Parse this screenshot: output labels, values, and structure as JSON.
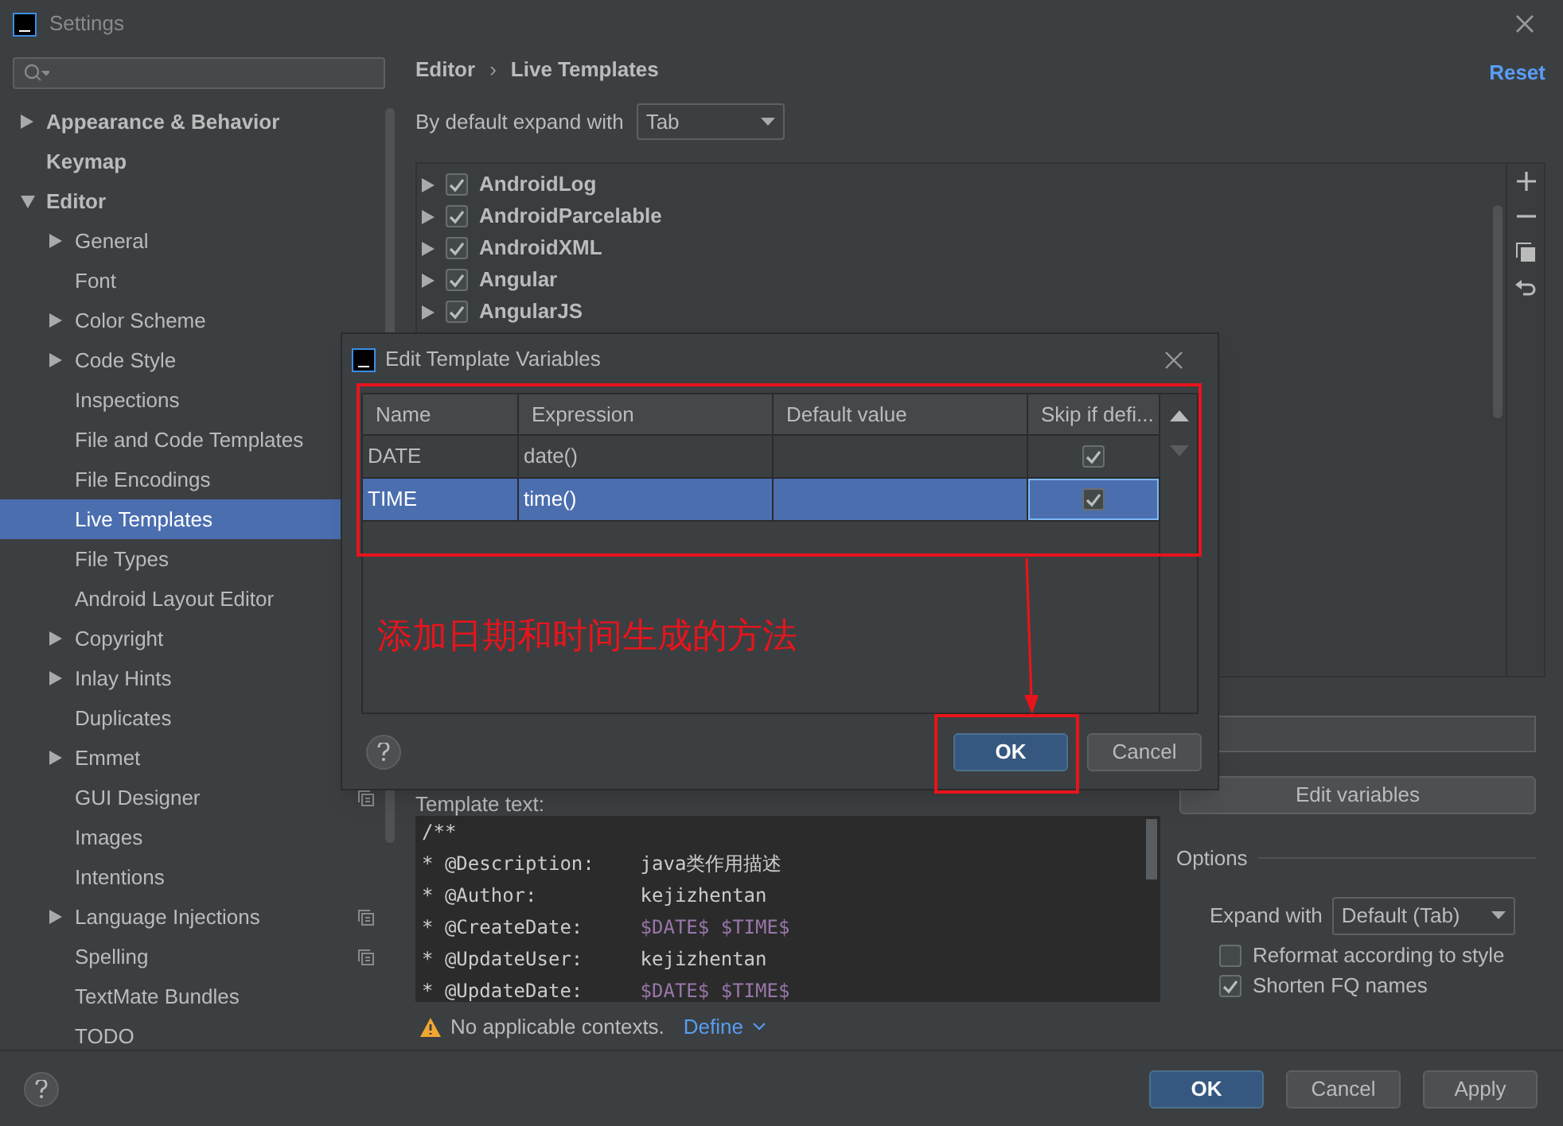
{
  "window": {
    "title": "Settings"
  },
  "sidebar": {
    "items": [
      {
        "label": "Appearance & Behavior",
        "kind": "folder",
        "expanded": false
      },
      {
        "label": "Keymap",
        "kind": "page"
      },
      {
        "label": "Editor",
        "kind": "folder",
        "expanded": true,
        "children": [
          {
            "label": "General",
            "kind": "folder",
            "expanded": false,
            "selected": false,
            "shared": false
          },
          {
            "label": "Font",
            "kind": "page",
            "selected": false,
            "shared": false
          },
          {
            "label": "Color Scheme",
            "kind": "folder",
            "expanded": false,
            "selected": false,
            "shared": false
          },
          {
            "label": "Code Style",
            "kind": "folder",
            "expanded": false,
            "selected": false,
            "shared": false
          },
          {
            "label": "Inspections",
            "kind": "page",
            "selected": false,
            "shared": false
          },
          {
            "label": "File and Code Templates",
            "kind": "page",
            "selected": false,
            "shared": false
          },
          {
            "label": "File Encodings",
            "kind": "page",
            "selected": false,
            "shared": false
          },
          {
            "label": "Live Templates",
            "kind": "page",
            "selected": true,
            "shared": false
          },
          {
            "label": "File Types",
            "kind": "page",
            "selected": false,
            "shared": false
          },
          {
            "label": "Android Layout Editor",
            "kind": "page",
            "selected": false,
            "shared": false
          },
          {
            "label": "Copyright",
            "kind": "folder",
            "expanded": false,
            "selected": false,
            "shared": false
          },
          {
            "label": "Inlay Hints",
            "kind": "folder",
            "expanded": false,
            "selected": false,
            "shared": false
          },
          {
            "label": "Duplicates",
            "kind": "page",
            "selected": false,
            "shared": false
          },
          {
            "label": "Emmet",
            "kind": "folder",
            "expanded": false,
            "selected": false,
            "shared": false
          },
          {
            "label": "GUI Designer",
            "kind": "page",
            "selected": false,
            "shared": true
          },
          {
            "label": "Images",
            "kind": "page",
            "selected": false,
            "shared": false
          },
          {
            "label": "Intentions",
            "kind": "page",
            "selected": false,
            "shared": false
          },
          {
            "label": "Language Injections",
            "kind": "folder",
            "expanded": false,
            "selected": false,
            "shared": true
          },
          {
            "label": "Spelling",
            "kind": "page",
            "selected": false,
            "shared": true
          },
          {
            "label": "TextMate Bundles",
            "kind": "page",
            "selected": false,
            "shared": false
          },
          {
            "label": "TODO",
            "kind": "page",
            "selected": false,
            "shared": false
          }
        ]
      }
    ]
  },
  "breadcrumb": [
    "Editor",
    "Live Templates"
  ],
  "breadcrumb_separator": "›",
  "reset_link": "Reset",
  "expand_label": "By default expand with",
  "expand_value": "Tab",
  "template_groups": [
    {
      "label": "AndroidLog",
      "checked": true
    },
    {
      "label": "AndroidParcelable",
      "checked": true
    },
    {
      "label": "AndroidXML",
      "checked": true
    },
    {
      "label": "Angular",
      "checked": true
    },
    {
      "label": "AngularJS",
      "checked": true
    }
  ],
  "template_text_label": "Template text:",
  "template_text": [
    [
      {
        "text": "/**",
        "kind": "plain"
      }
    ],
    [
      {
        "text": "* @Description:    ",
        "kind": "plain"
      },
      {
        "text": "java类作用描述",
        "kind": "plain"
      }
    ],
    [
      {
        "text": "* @Author:         ",
        "kind": "plain"
      },
      {
        "text": "kejizhentan",
        "kind": "plain"
      }
    ],
    [
      {
        "text": "* @CreateDate:     ",
        "kind": "plain"
      },
      {
        "text": "$DATE$ $TIME$",
        "kind": "variable"
      }
    ],
    [
      {
        "text": "* @UpdateUser:     ",
        "kind": "plain"
      },
      {
        "text": "kejizhentan",
        "kind": "plain"
      }
    ],
    [
      {
        "text": "* @UpdateDate:     ",
        "kind": "plain"
      },
      {
        "text": "$DATE$ $TIME$",
        "kind": "variable"
      }
    ]
  ],
  "context_warning": "No applicable contexts.",
  "define_link": "Define",
  "edit_variables_button": "Edit variables",
  "options": {
    "title": "Options",
    "expand_label": "Expand with",
    "expand_value": "Default (Tab)",
    "checkboxes": [
      {
        "label": "Reformat according to style",
        "checked": false
      },
      {
        "label": "Shorten FQ names",
        "checked": true
      }
    ]
  },
  "buttons": [
    {
      "label": "OK",
      "primary": true
    },
    {
      "label": "Cancel",
      "primary": false
    },
    {
      "label": "Apply",
      "primary": false
    }
  ],
  "dialog": {
    "title": "Edit Template Variables",
    "columns": [
      "Name",
      "Expression",
      "Default value",
      "Skip if defi..."
    ],
    "rows": [
      {
        "name": "DATE",
        "expression": "date()",
        "skip": true,
        "selected": false
      },
      {
        "name": "TIME",
        "expression": "time()",
        "skip": true,
        "selected": true
      }
    ],
    "buttons": [
      {
        "label": "OK",
        "primary": true
      },
      {
        "label": "Cancel",
        "primary": false
      }
    ]
  },
  "annotation": {
    "text": "添加日期和时间生成的方法"
  }
}
